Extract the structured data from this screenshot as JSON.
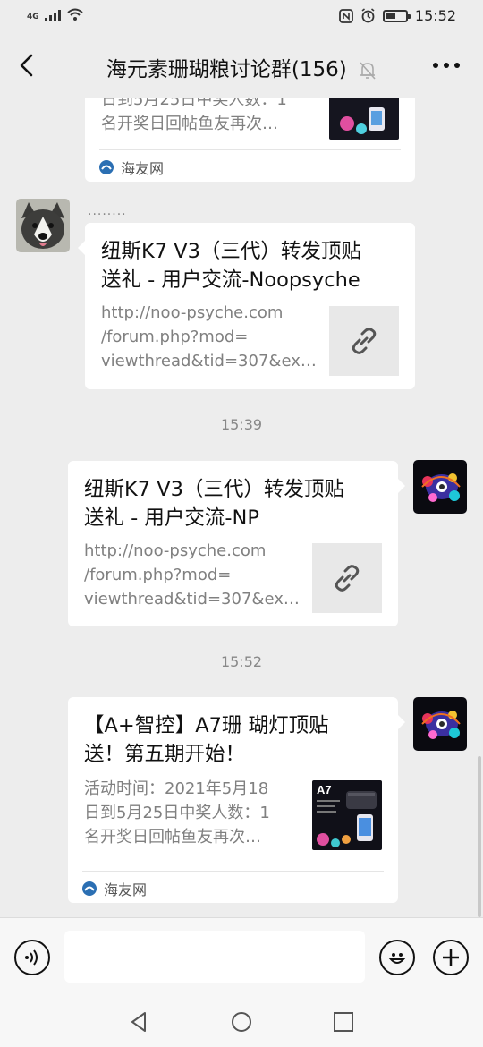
{
  "status_bar": {
    "network": "4G",
    "time": "15:52",
    "battery_level": 0.5
  },
  "header": {
    "title": "海元素珊瑚粮讨论群(156)",
    "back_icon": "chevron-left-icon",
    "mute_icon": "bell-off-icon",
    "more_icon": "more-dots-icon"
  },
  "messages": [
    {
      "type": "link-card-partial",
      "desc_tail_1": "日到5月25日中奖人数：1",
      "desc_tail_2": "名开奖日回帖鱼友再次…",
      "source": "海友网"
    },
    {
      "type": "link-card",
      "sender_name": "........",
      "title": "纽斯K7 V3（三代）转发顶贴送礼 - 用户交流-Noopsyche",
      "desc": "http://noo-psyche.com/forum.php?mod=viewthread&tid=307&ex…",
      "desc_lines": [
        "http://noo-psyche.com",
        "/forum.php?mod=",
        "viewthread&tid=307&ex…"
      ],
      "thumb_icon": "link-icon"
    },
    {
      "type": "time",
      "text": "15:39"
    },
    {
      "type": "link-card-self",
      "title_lines": [
        "纽斯K7 V3（三代）转发顶贴",
        "送礼 - 用户交流-NP"
      ],
      "desc_lines": [
        "http://noo-psyche.com",
        "/forum.php?mod=",
        "viewthread&tid=307&ex…"
      ],
      "thumb_icon": "link-icon"
    },
    {
      "type": "time",
      "text": "15:52"
    },
    {
      "type": "link-card-self",
      "title_lines": [
        "【A+智控】A7珊 瑚灯顶贴",
        "送！第五期开始！"
      ],
      "desc_lines": [
        "活动时间：2021年5月18",
        "日到5月25日中奖人数：1",
        "名开奖日回帖鱼友再次…"
      ],
      "thumb_text": "A7",
      "source": "海友网"
    }
  ],
  "title_lines_msg2": [
    "纽斯K7 V3（三代）转发顶贴",
    "送礼 - 用户交流-Noopsyche"
  ],
  "input_bar": {
    "voice_icon": "voice-icon",
    "message_value": "",
    "emoji_icon": "emoji-icon",
    "plus_icon": "plus-icon"
  },
  "nav_bar": {
    "back_icon": "triangle-back-icon",
    "home_icon": "circle-home-icon",
    "recents_icon": "square-recents-icon"
  },
  "colors": {
    "background": "#ededed",
    "card": "#ffffff",
    "text_secondary": "#808080"
  }
}
